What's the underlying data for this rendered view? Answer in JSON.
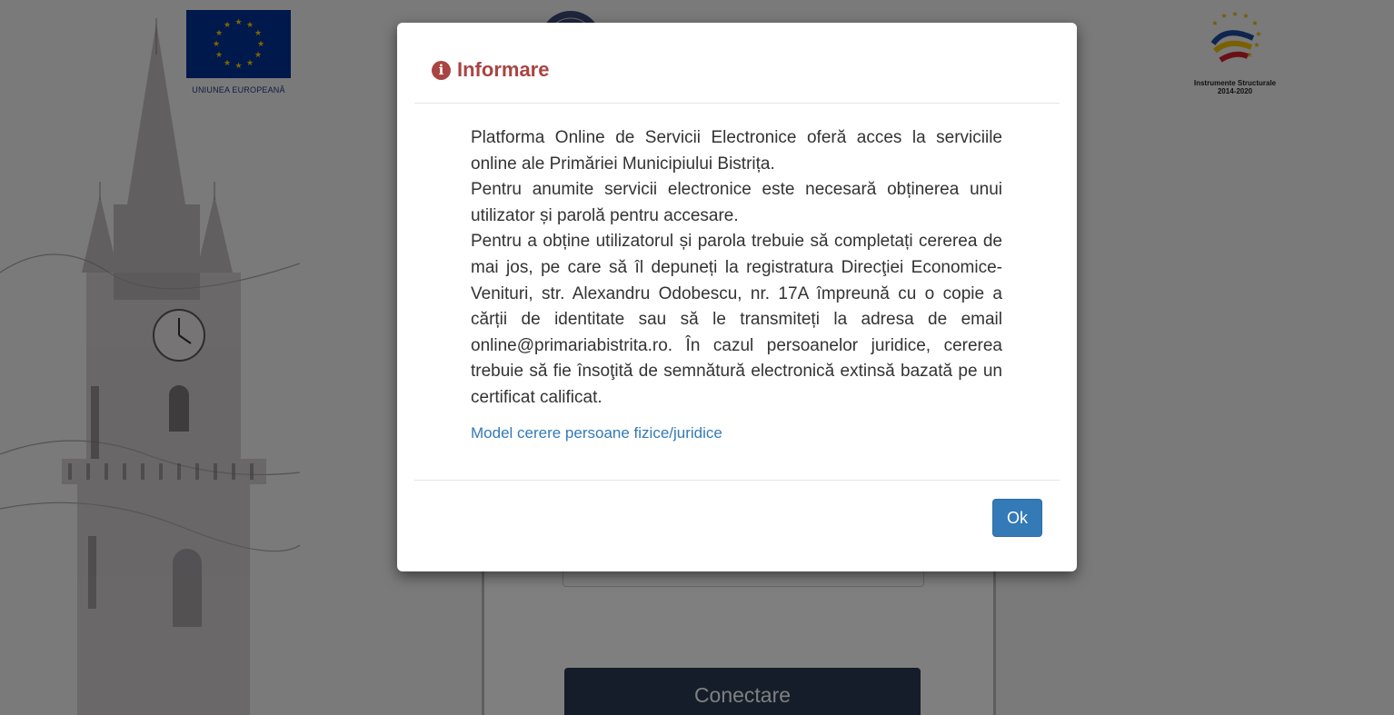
{
  "background": {
    "eu_logo_caption": "UNIUNEA EUROPEANĂ",
    "structural_logo_caption_line1": "Instrumente Structurale",
    "structural_logo_caption_line2": "2014-2020",
    "connect_button_label": "Conectare"
  },
  "modal": {
    "title": "Informare",
    "title_icon": "info-circle-icon",
    "paragraphs": [
      "Platforma Online de Servicii Electronice oferă acces la serviciile online ale Primăriei Municipiului Bistrița.",
      "Pentru anumite servicii electronice este necesară obținerea unui utilizator și parolă pentru accesare.",
      "Pentru a obține utilizatorul și parola trebuie să completați cererea de mai jos, pe care să îl depuneți la registratura Direcţiei Economice-Venituri, str. Alexandru Odobescu, nr. 17A împreună cu o copie a cărții de identitate sau să le transmiteți la adresa de email online@primariabistrita.ro. În cazul persoanelor juridice, cererea trebuie să fie însoţită de semnătură electronică extinsă bazată pe un certificat calificat."
    ],
    "link_label": "Model cerere persoane fizice/juridice",
    "ok_label": "Ok"
  },
  "colors": {
    "title": "#a94442",
    "link": "#337ab7",
    "primary_button": "#337ab7",
    "connect_button": "#2b3a55",
    "eu_blue": "#003399"
  }
}
